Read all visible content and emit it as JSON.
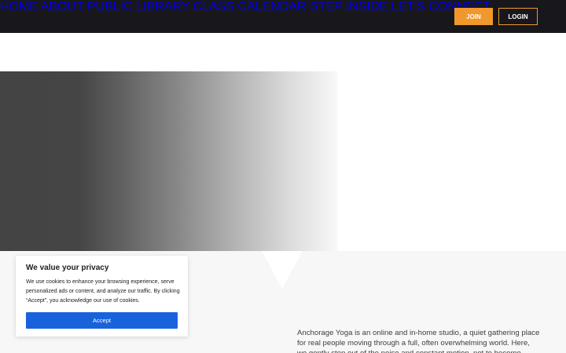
{
  "nav": {
    "items": [
      {
        "label": "HOME"
      },
      {
        "label": "ABOUT"
      },
      {
        "label": "PUBLIC LIBRARY"
      },
      {
        "label": "CLASS CALENDAR"
      },
      {
        "label": "STEP INSIDE"
      },
      {
        "label": "LET'S CONNECT"
      }
    ],
    "join_label": "JOIN",
    "login_label": "LOGIN"
  },
  "colors": {
    "header_bg": "#18171c",
    "accent": "#f0982c",
    "cookie_button": "#1863dc"
  },
  "about": {
    "text": "Anchorage Yoga is an online and in-home studio, a quiet gathering place for real people moving through a full, often overwhelming world. Here, we gently step out of the noise and constant motion, not to become someone"
  },
  "cookie_banner": {
    "title": "We value your privacy",
    "body": "We use cookies to enhance your browsing experience, serve personalized ads or content, and analyze our traffic. By clicking “Accept”, you acknowledge our use of cookies.",
    "accept_label": "Accept"
  }
}
